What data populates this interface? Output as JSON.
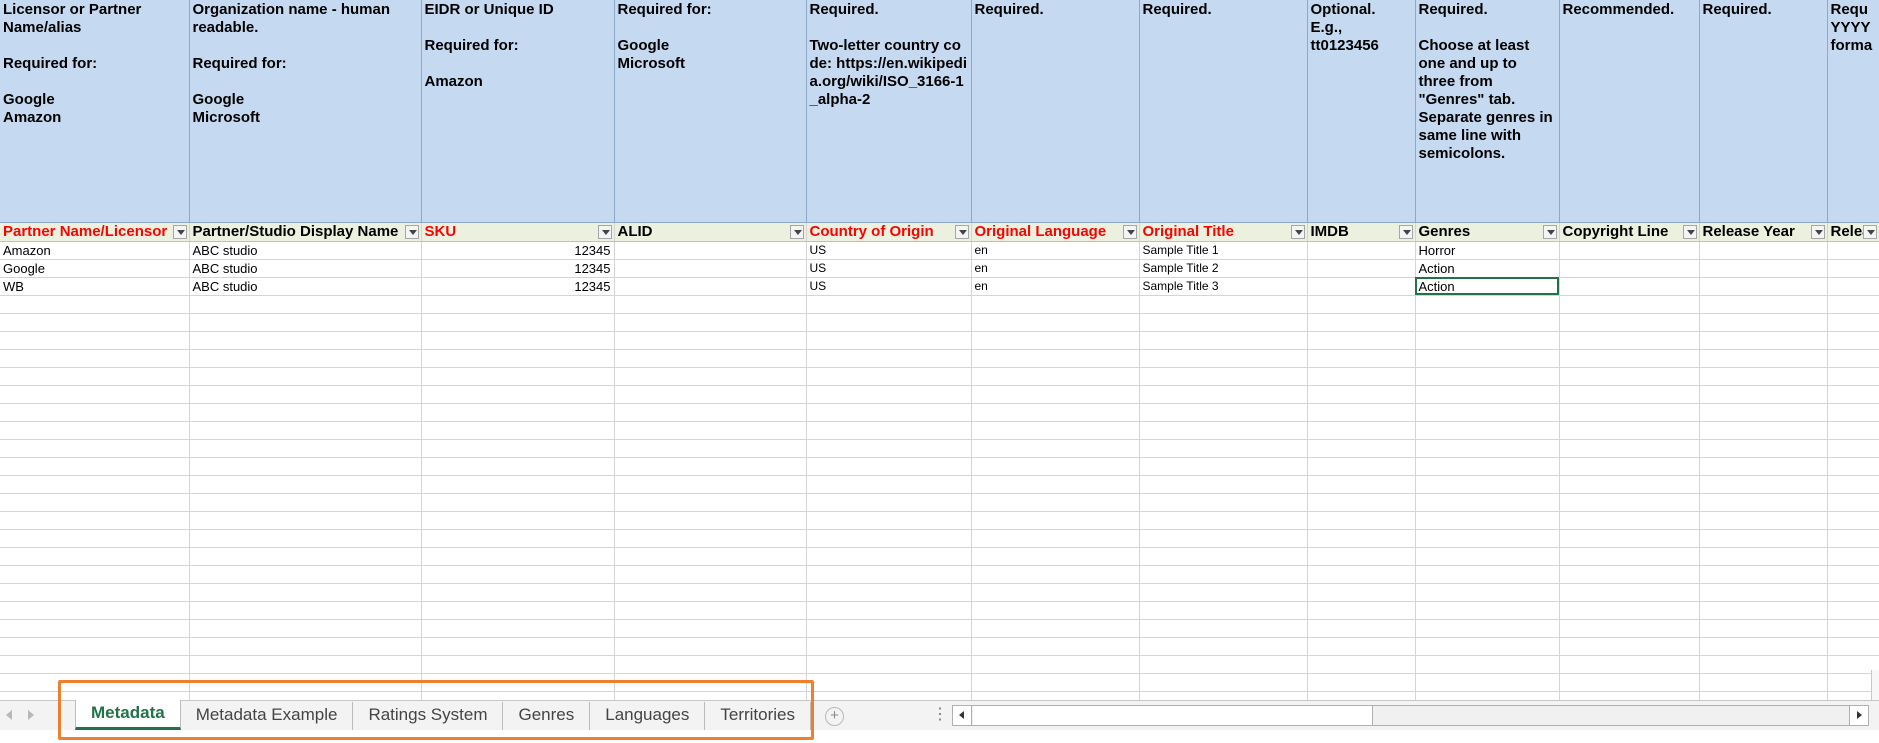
{
  "columns": [
    {
      "width": 189,
      "desc": "Licensor or Partner Name/alias\n\nRequired for:\n\nGoogle\nAmazon",
      "header": "Partner Name/Licensor",
      "required": true
    },
    {
      "width": 232,
      "desc": "Organization name - human readable.\n\nRequired for:\n\nGoogle\nMicrosoft",
      "header": "Partner/Studio Display Name",
      "required": false
    },
    {
      "width": 193,
      "desc": "EIDR or Unique ID\n\nRequired for:\n\nAmazon",
      "header": "SKU",
      "required": true
    },
    {
      "width": 192,
      "desc": "Required for:\n\nGoogle\nMicrosoft",
      "header": "ALID",
      "required": false
    },
    {
      "width": 165,
      "desc": "Required.\n\nTwo-letter country code: https://en.wikipedia.org/wiki/ISO_3166-1_alpha-2",
      "header": "Country of Origin",
      "required": true,
      "url": true
    },
    {
      "width": 168,
      "desc": "Required.",
      "header": "Original Language",
      "required": true
    },
    {
      "width": 168,
      "desc": "Required.",
      "header": "Original Title",
      "required": true
    },
    {
      "width": 108,
      "desc": "Optional.\nE.g., tt0123456",
      "header": "IMDB",
      "required": false
    },
    {
      "width": 144,
      "desc": "Required.\n\nChoose at least one and up to three from \"Genres\" tab. Separate genres in same line with semicolons.",
      "header": "Genres",
      "required": false
    },
    {
      "width": 140,
      "desc": "Recommended.",
      "header": "Copyright Line",
      "required": false
    },
    {
      "width": 128,
      "desc": "Required.",
      "header": "Release Year",
      "required": false
    },
    {
      "width": 52,
      "desc": "Requ\nYYYY\nforma",
      "header": "Relea",
      "required": false
    }
  ],
  "rows": [
    [
      "Amazon",
      "ABC studio",
      "12345",
      "",
      "US",
      "en",
      "Sample Title 1",
      "",
      "Horror",
      "",
      "",
      ""
    ],
    [
      "Google",
      "ABC studio",
      "12345",
      "",
      "US",
      "en",
      "Sample Title 2",
      "",
      "Action",
      "",
      "",
      ""
    ],
    [
      "WB",
      "ABC studio",
      "12345",
      "",
      "US",
      "en",
      "Sample Title 3",
      "",
      "Action",
      "",
      "",
      ""
    ]
  ],
  "active_cell": {
    "row": 2,
    "col": 8
  },
  "sheet_tabs": [
    "Metadata",
    "Metadata Example",
    "Ratings System",
    "Genres",
    "Languages",
    "Territories"
  ],
  "active_tab": 0,
  "add_sheet_symbol": "+",
  "tab_options_symbol": "⋮",
  "colors": {
    "accent": "#217346",
    "header_blue": "#c5d9f1",
    "filter_row": "#ebf1de",
    "required_text": "#ff0000",
    "highlight": "#f07f2d"
  }
}
